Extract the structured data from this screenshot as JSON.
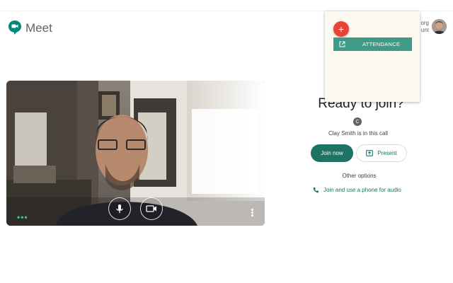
{
  "header": {
    "app_title": "Meet",
    "account_line1": "org",
    "account_line2": "unt"
  },
  "video": {
    "mic_icon": "microphone-icon",
    "cam_icon": "videocam-icon",
    "more_icon": "more-vert-icon",
    "effects_icon": "dots-icon"
  },
  "join": {
    "heading": "Ready to join?",
    "participant_initial": "C",
    "in_call_text": "Clay Smith is in this call",
    "join_label": "Join now",
    "present_label": "Present",
    "other_options": "Other options",
    "phone_label": "Join and use a phone for audio"
  },
  "popup": {
    "fab_label": "+",
    "attendance_label": "ATTENDANCE"
  },
  "colors": {
    "accent": "#1e7364",
    "attendance": "#3f9a86",
    "fab": "#ea4335",
    "popup_bg": "#fcfaf0"
  }
}
